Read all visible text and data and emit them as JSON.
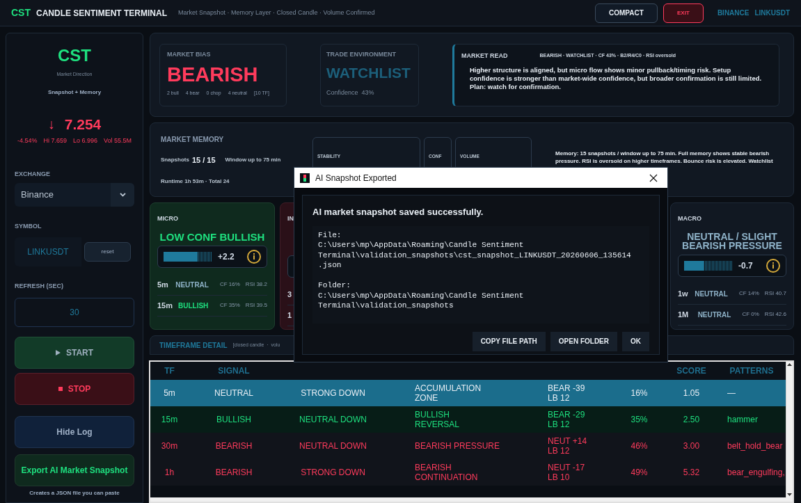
{
  "header": {
    "logo": "CST",
    "title": "CANDLE SENTIMENT TERMINAL",
    "subtitle": "Market Snapshot · Memory Layer · Closed Candle · Volume Confirmed",
    "buttons": [
      {
        "label": "COMPACT",
        "kind": "normal"
      },
      {
        "label": "EXIT",
        "kind": "danger"
      }
    ],
    "exchange": "BINANCE",
    "symbol": "LINKUSDT"
  },
  "sidebar": {
    "logo": "CST",
    "caption": "Market Direction",
    "mode": "Snapshot + Memory",
    "arrow": "↓",
    "price": "7.254",
    "stats": [
      "-4.54%",
      "Hi 7.659",
      "Lo 6.996",
      "Vol 55.5M"
    ],
    "exchange_label": "EXCHANGE",
    "exchange_value": "Binance",
    "symbol_label": "SYMBOL",
    "symbol_value": "LINKUSDT",
    "reset_label": "reset",
    "refresh_label": "REFRESH (SEC)",
    "refresh_value": "30",
    "buttons": [
      {
        "label": "START",
        "kind": "start"
      },
      {
        "label": "STOP",
        "kind": "stop"
      },
      {
        "label": "Hide Log",
        "kind": "plain"
      },
      {
        "label": "Export AI Market Snapshot",
        "kind": "export"
      }
    ],
    "note": "Creates a JSON file you can paste"
  },
  "bias": {
    "label": "MARKET BIAS",
    "value": "BEARISH",
    "counts": [
      "2 bull",
      "4 bear",
      "0 chop",
      "4 neutral",
      "[10 TF]"
    ]
  },
  "environment": {
    "label": "TRADE ENVIRONMENT",
    "value": "WATCHLIST",
    "confidence": "Confidence  43%"
  },
  "market_read": {
    "title": "MARKET READ",
    "tags": "BEARISH · WATCHLIST · CF 43% · B2/R4/C0 · RSI oversold",
    "text": "Higher structure is aligned, but micro flow shows minor pullback/timing risk. Setup confidence is stronger than market-wide confidence, but broader confirmation is still limited.  Plan: watch for confirmation."
  },
  "memory": {
    "title": "MARKET MEMORY",
    "snapshots_label": "Snapshots",
    "snapshots": "15 / 15",
    "window": "Window up to 75 min",
    "runtime": "Runtime 1h 53m · Total 24",
    "boxes": [
      "STABILITY",
      "CONF",
      "VOLUME"
    ],
    "text": "Memory: 15 snapshots / window up to 75 min. Full memory shows stable bearish pressure. RSI is oversold on higher timeframes. Bounce risk is elevated. Watchlist"
  },
  "cards": [
    {
      "title": "MICRO",
      "kind": "bullish",
      "signal": "LOW CONF BULLISH",
      "level": 0.7,
      "reading": "+2.2",
      "rows": [
        {
          "tf": "5m",
          "kind": "neutral",
          "signal": "NEUTRAL",
          "cf": "CF 16%",
          "rsi": "RSI 38.2"
        },
        {
          "tf": "15m",
          "kind": "bullish",
          "signal": "BULLISH",
          "cf": "CF 35%",
          "rsi": "RSI 39.5"
        }
      ]
    },
    {
      "title": "IN",
      "kind": "bearish",
      "rows": [
        {
          "tf": "3"
        },
        {
          "tf": "1"
        }
      ]
    },
    {
      "title": "MACRO",
      "kind": "neutral",
      "signal": "NEUTRAL / SLIGHT BEARISH PRESSURE",
      "level": 0.4,
      "reading": "-0.7",
      "rows": [
        {
          "tf": "1w",
          "kind": "neutral",
          "signal": "NEUTRAL",
          "cf": "CF 14%",
          "rsi": "RSI 40.7"
        },
        {
          "tf": "1M",
          "kind": "neutral",
          "signal": "NEUTRAL",
          "cf": "CF 0%",
          "rsi": "RSI 42.6"
        }
      ]
    }
  ],
  "timeframe_detail": {
    "title": "TIMEFRAME DETAIL",
    "note": "[closed candle  ·  volu"
  },
  "table": {
    "columns": [
      "TF",
      "SIGNAL",
      "",
      "",
      "",
      "",
      "SCORE",
      "PATTERNS"
    ],
    "rows": [
      {
        "selected": true,
        "kind": "neutral",
        "cells": [
          "5m",
          "NEUTRAL",
          "STRONG DOWN",
          "ACCUMULATION\nZONE",
          "BEAR -39\nLB 12",
          "16%",
          "1.05",
          "—"
        ]
      },
      {
        "selected": false,
        "kind": "bullish",
        "cells": [
          "15m",
          "BULLISH",
          "NEUTRAL DOWN",
          "BULLISH\nREVERSAL",
          "BEAR -29\nLB 12",
          "35%",
          "2.50",
          "hammer"
        ]
      },
      {
        "selected": false,
        "kind": "bearish",
        "cells": [
          "30m",
          "BEARISH",
          "NEUTRAL DOWN",
          "BEARISH PRESSURE",
          "NEUT +14\nLB 12",
          "46%",
          "3.00",
          "belt_hold_bear"
        ]
      },
      {
        "selected": false,
        "kind": "bearish",
        "cells": [
          "1h",
          "BEARISH",
          "STRONG DOWN",
          "BEARISH\nCONTINUATION",
          "NEUT -17\nLB 10",
          "49%",
          "5.32",
          "bear_engulfing,"
        ]
      }
    ]
  },
  "dialog": {
    "title": "AI Snapshot Exported",
    "heading": "AI market snapshot saved successfully.",
    "message": "File:\nC:\\Users\\mp\\AppData\\Roaming\\Candle Sentiment Terminal\\validation_snapshots\\cst_snapshot_LINKUSDT_20260606_135614.json\n\nFolder:\nC:\\Users\\mp\\AppData\\Roaming\\Candle Sentiment Terminal\\validation_snapshots",
    "buttons": [
      "COPY FILE PATH",
      "OPEN FOLDER",
      "OK"
    ]
  }
}
